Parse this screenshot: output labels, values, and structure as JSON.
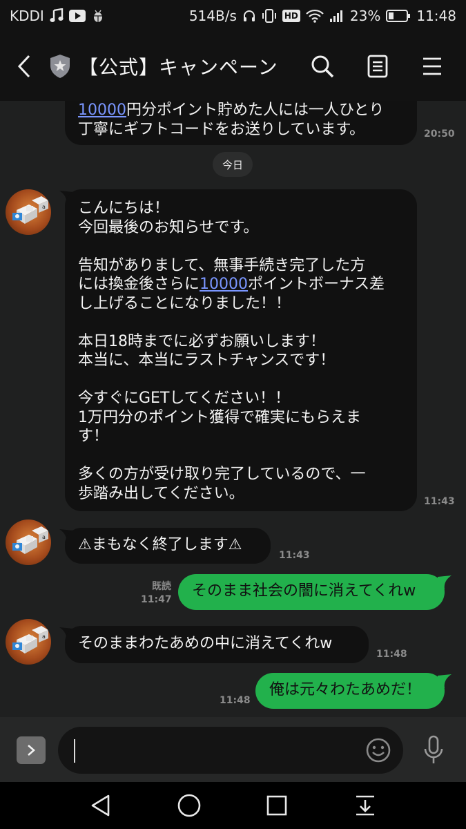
{
  "status_bar": {
    "carrier": "KDDI",
    "net_speed": "514B/s",
    "hd_badge": "HD",
    "battery": "23%",
    "time": "11:48"
  },
  "header": {
    "title": "【公式】キャンペーン"
  },
  "chat": {
    "prev_message": {
      "link": "10000",
      "text_after_link": "円分ポイント貯めた人には一人ひとり",
      "line2": "丁寧にギフトコードをお送りしています。",
      "time": "20:50"
    },
    "day_separator": "今日",
    "long_message": {
      "part1": "こんにちは！\n今回最後のお知らせです。\n\n告知がありまして、無事手続き完了した方\nには換金後さらに",
      "link": "10000",
      "part2": "ポイントボーナス差\nし上げることになりました！！\n\n本日18時までに必ずお願いします！\n本当に、本当にラストチャンスです！\n\n今すぐにGETしてください！！\n1万円分のポイント獲得で確実にもらえま\nす！\n\n多くの方が受け取り完了しているので、一\n歩踏み出してください。",
      "time": "11:43"
    },
    "warning_message": {
      "text": "⚠まもなく終了します⚠",
      "time": "11:43"
    },
    "reply1": {
      "text": "そのまま社会の闇に消えてくれw",
      "read_label": "既読",
      "time": "11:47"
    },
    "incoming2": {
      "text": "そのままわたあめの中に消えてくれw",
      "time": "11:48"
    },
    "reply2": {
      "text": "俺は元々わたあめだ！",
      "time": "11:48"
    }
  },
  "input": {
    "placeholder": ""
  },
  "colors": {
    "outgoing_bubble": "#22b14c",
    "incoming_bubble": "#111111",
    "link": "#7a96ff",
    "background": "#1f2020"
  },
  "icons": [
    "music-note-icon",
    "youtube-icon",
    "android-debug-icon",
    "headphones-icon",
    "vibrate-icon",
    "wifi-icon",
    "signal-icon",
    "battery-icon",
    "back-icon",
    "shield-star-icon",
    "search-icon",
    "notes-icon",
    "menu-icon",
    "chevron-right-icon",
    "emoji-icon",
    "mic-icon",
    "nav-back-icon",
    "nav-home-icon",
    "nav-recents-icon",
    "nav-notifications-icon"
  ]
}
